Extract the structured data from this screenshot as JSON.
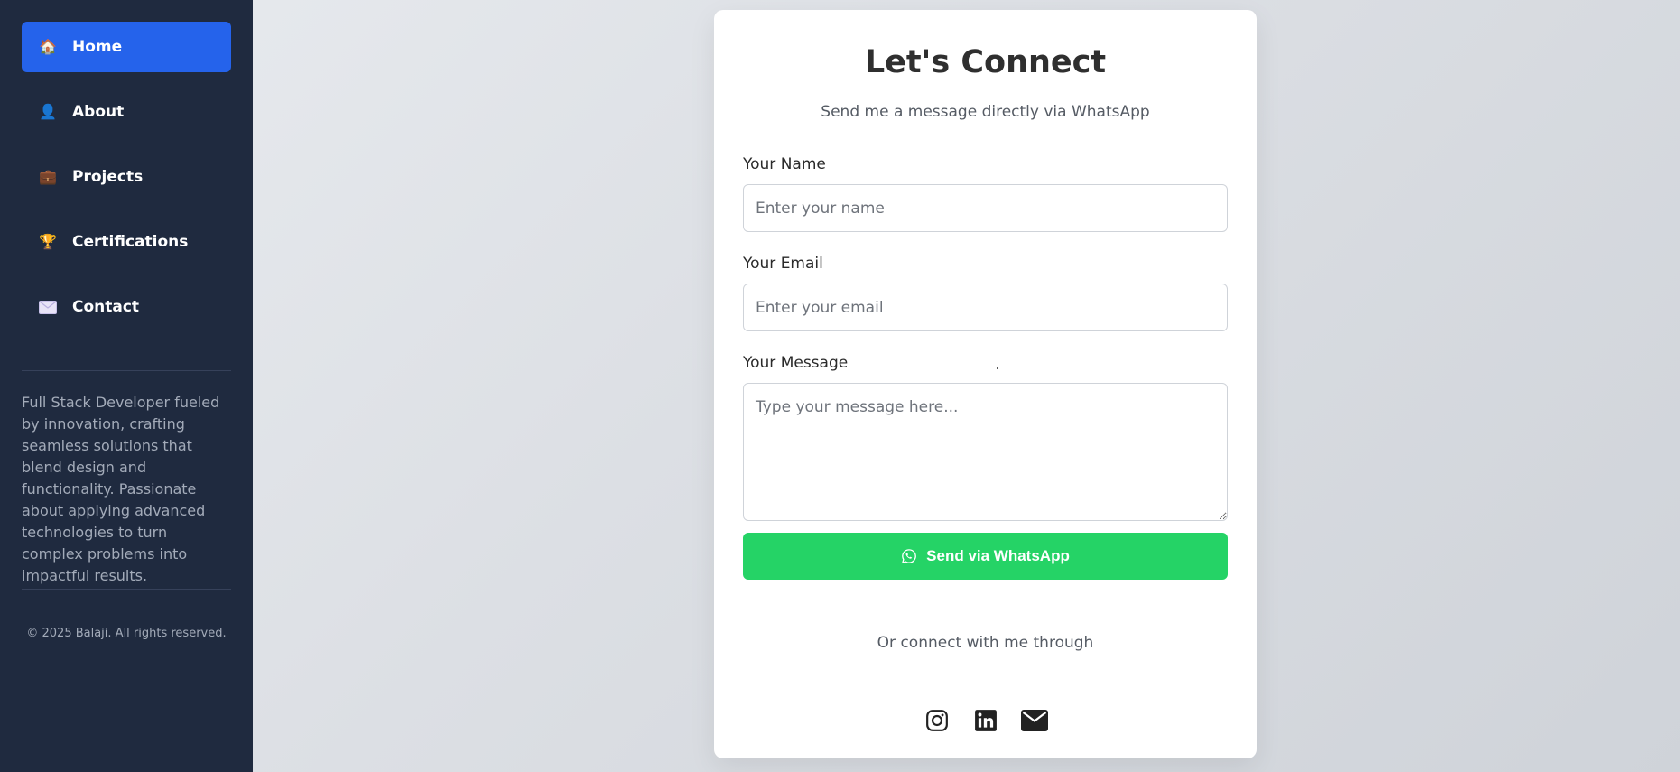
{
  "sidebar": {
    "items": [
      {
        "label": "Home",
        "icon": "house-icon",
        "glyph": "🏠",
        "active": true
      },
      {
        "label": "About",
        "icon": "person-icon",
        "glyph": "👤",
        "active": false
      },
      {
        "label": "Projects",
        "icon": "briefcase-icon",
        "glyph": "💼",
        "active": false
      },
      {
        "label": "Certifications",
        "icon": "trophy-icon",
        "glyph": "🏆",
        "active": false
      },
      {
        "label": "Contact",
        "icon": "envelope-icon",
        "glyph": "✉",
        "active": false
      }
    ],
    "bio": "Full Stack Developer fueled by innovation, crafting seamless solutions that blend design and functionality. Passionate about applying advanced technologies to turn complex problems into impactful results.",
    "copyright": "© 2025 Balaji. All rights reserved."
  },
  "contact": {
    "title": "Let's Connect",
    "subtitle": "Send me a message directly via WhatsApp",
    "name_label": "Your Name",
    "name_placeholder": "Enter your name",
    "email_label": "Your Email",
    "email_placeholder": "Enter your email",
    "message_label": "Your Message",
    "message_placeholder": "Type your message here...",
    "send_label": "Send via WhatsApp",
    "or_text": "Or connect with me through",
    "socials": [
      "instagram-icon",
      "linkedin-icon",
      "mail-icon"
    ]
  },
  "colors": {
    "sidebar_bg": "#1f2a3f",
    "active_nav": "#2563eb",
    "whatsapp_green": "#25d366",
    "card_bg": "#ffffff"
  }
}
